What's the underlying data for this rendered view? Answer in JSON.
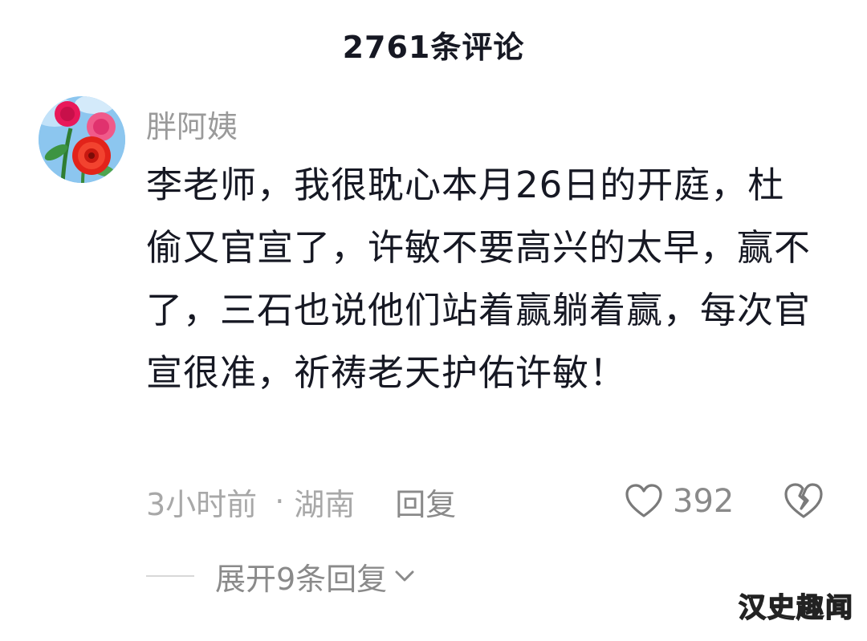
{
  "header": {
    "title": "2761条评论"
  },
  "comment": {
    "author": "胖阿姨",
    "avatar_icon": "rose-flower-avatar",
    "text": "李老师，我很耽心本月26日的开庭，杜偷又官宣了，许敏不要高兴的太早，赢不了，三石也说他们站着赢躺着赢，每次官宣很准，祈祷老天护佑许敏！",
    "time": "3小时前",
    "separator": "·",
    "location": "湖南",
    "reply_label": "回复",
    "like_icon": "heart-outline-icon",
    "like_count": "392",
    "dislike_icon": "broken-heart-icon"
  },
  "replies": {
    "expand_label": "展开9条回复",
    "expand_icon": "chevron-down-icon"
  },
  "watermark": {
    "text": "汉史趣闻"
  },
  "colors": {
    "primary_text": "#161823",
    "secondary_text": "#9a9a9a",
    "background": "#ffffff"
  }
}
